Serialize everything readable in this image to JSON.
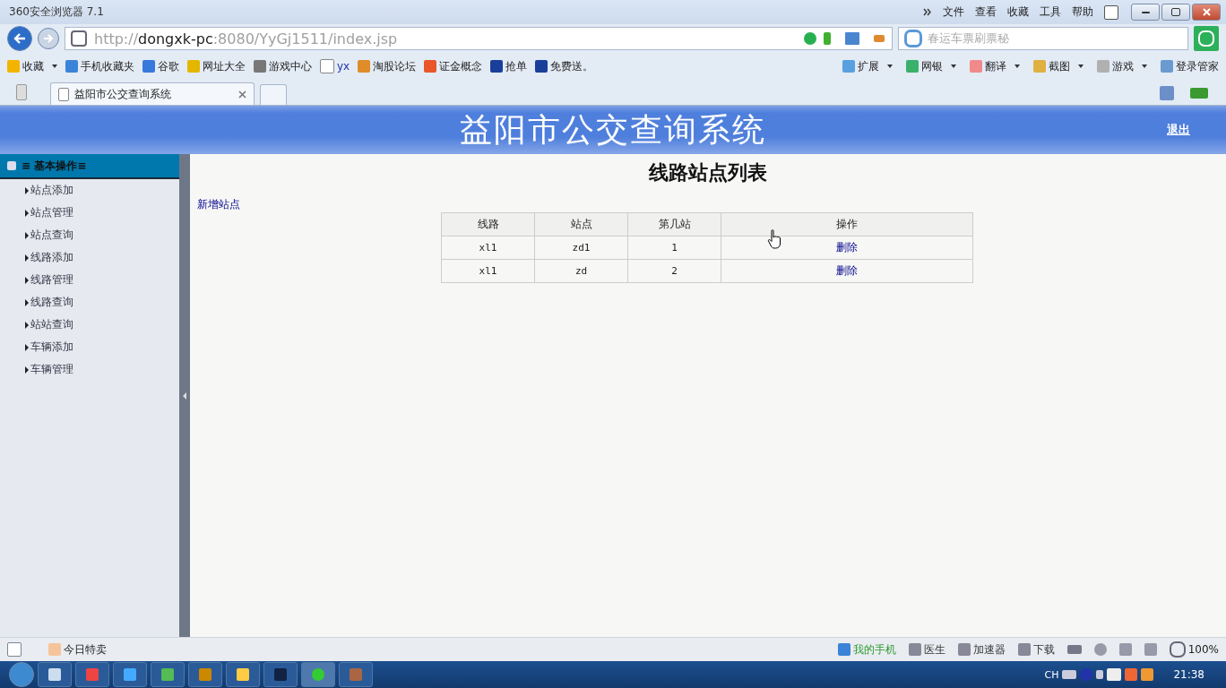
{
  "window": {
    "title": "360安全浏览器 7.1",
    "menus": [
      "文件",
      "查看",
      "收藏",
      "工具",
      "帮助"
    ]
  },
  "address": {
    "scheme": "http://",
    "host": "dongxk-pc",
    "rest": ":8080/YyGj1511/index.jsp"
  },
  "search": {
    "placeholder": "春运车票刷票秘"
  },
  "bookmarks": [
    {
      "label": "收藏",
      "dropdown": true
    },
    {
      "label": "手机收藏夹",
      "dropdown": false
    },
    {
      "label": "谷歌",
      "dropdown": false
    },
    {
      "label": "网址大全",
      "dropdown": false
    },
    {
      "label": "游戏中心",
      "dropdown": false
    },
    {
      "label": "yx",
      "dropdown": false
    },
    {
      "label": "淘股论坛",
      "dropdown": false
    },
    {
      "label": "证金概念",
      "dropdown": false
    },
    {
      "label": "抢单",
      "dropdown": false
    },
    {
      "label": "免费送。",
      "dropdown": false
    }
  ],
  "tools": [
    {
      "label": "扩展",
      "dropdown": true
    },
    {
      "label": "网银",
      "dropdown": true
    },
    {
      "label": "翻译",
      "dropdown": true
    },
    {
      "label": "截图",
      "dropdown": true
    },
    {
      "label": "游戏",
      "dropdown": true
    },
    {
      "label": "登录管家",
      "dropdown": false
    }
  ],
  "tabs": [
    {
      "label": "益阳市公交查询系统",
      "selected": true
    }
  ],
  "page": {
    "header": {
      "title": "益阳市公交查询系统",
      "logout": "退出"
    },
    "sidebar": {
      "group": "≡ 基本操作≡",
      "items": [
        "站点添加",
        "站点管理",
        "站点查询",
        "线路添加",
        "线路管理",
        "线路查询",
        "站站查询",
        "车辆添加",
        "车辆管理"
      ]
    },
    "main": {
      "heading": "线路站点列表",
      "add_link": "新增站点",
      "table": {
        "columns": [
          "线路",
          "站点",
          "第几站",
          "操作"
        ],
        "rows": [
          {
            "line": "xl1",
            "stop": "zd1",
            "order": "1",
            "action": "删除"
          },
          {
            "line": "xl1",
            "stop": "zd",
            "order": "2",
            "action": "删除"
          }
        ]
      }
    }
  },
  "status_bar": {
    "left": "今日特卖",
    "right": [
      {
        "label": "我的手机",
        "highlight": true
      },
      {
        "label": "医生",
        "highlight": false
      },
      {
        "label": "加速器",
        "highlight": false
      },
      {
        "label": "下载",
        "highlight": false
      }
    ],
    "zoom": "100%"
  },
  "taskbar": {
    "input": "CH",
    "clock": "21:38"
  }
}
